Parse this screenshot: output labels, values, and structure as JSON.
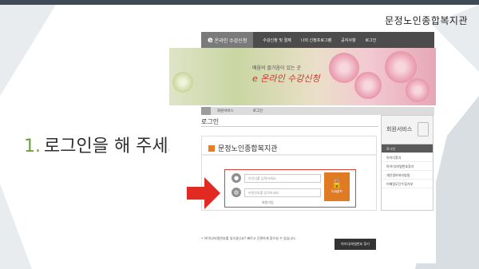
{
  "slide": {
    "brand": "문정노인종합복지관",
    "step_number": "1.",
    "step_text": "로그인을 해 주세요"
  },
  "site": {
    "logo_e": "e",
    "logo_text": "온라인 수강신청",
    "menu": [
      "수강신청 및 결제",
      "나의 신청프로그램",
      "공지사항",
      "로그인"
    ],
    "hero_slogan": "배움의 즐거움이 있는 곳",
    "hero_brand": "e 온라인 수강신청",
    "breadcrumbs": [
      "회원서비스",
      "로그인"
    ],
    "page_heading": "로그인",
    "org_name": "문정노인종합복지관",
    "id_placeholder": "아이디를 입력하세요.",
    "pw_placeholder": "비밀번호를 입력하세요.",
    "login_button": "Login",
    "join_link": "회원가입",
    "footer_note": "• 아이디/비밀번호를 잊으셨나요? 빠르고 간편하게 찾으실 수 있습니다.",
    "footer_button": "아이디/비밀번호 찾기",
    "side_title": "회원서비스",
    "side_items": [
      "로그인",
      "아이디찾기",
      "아이디/비밀번호찾기",
      "개인정보처리방침",
      "이메일무단수집거부"
    ]
  },
  "colors": {
    "accent_green": "#6aa13a",
    "highlight_red": "#d9443a",
    "login_orange": "#e07b24"
  }
}
